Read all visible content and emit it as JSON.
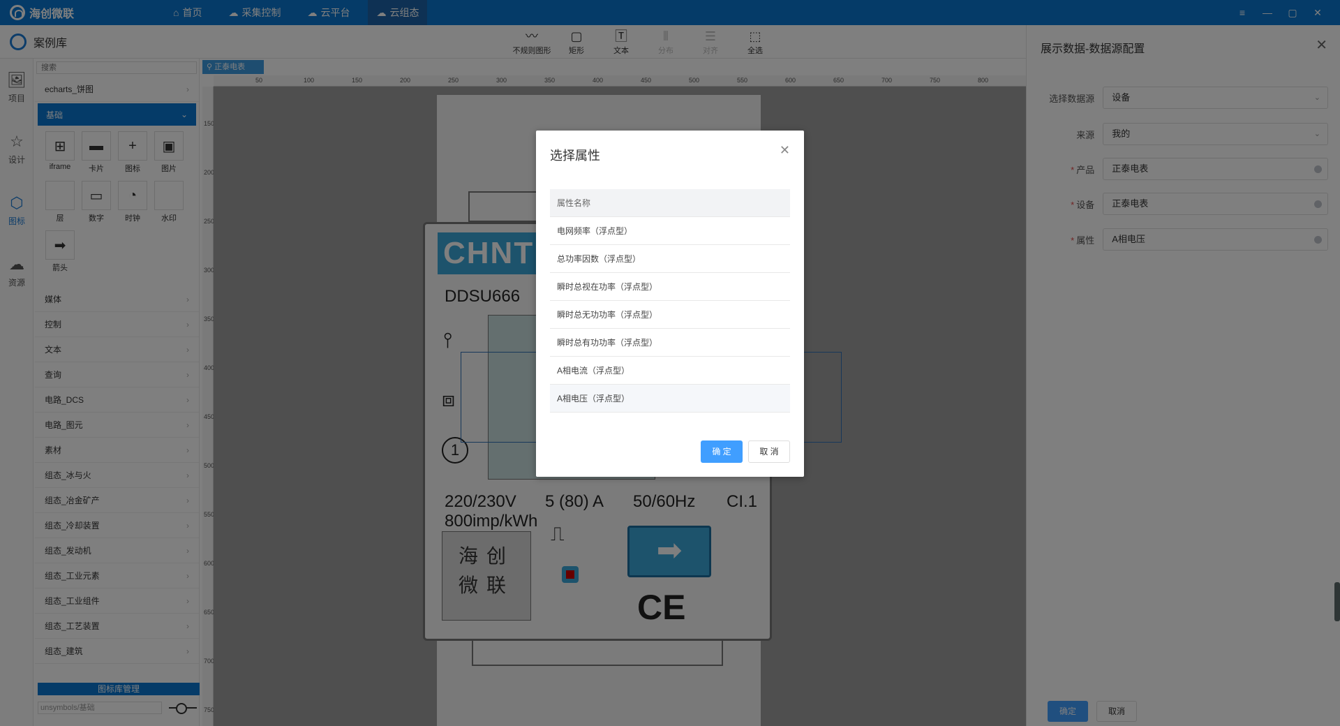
{
  "topbar": {
    "brand": "海创微联",
    "nav": [
      {
        "label": "首页",
        "icon": "⌂"
      },
      {
        "label": "采集控制",
        "icon": "☁"
      },
      {
        "label": "云平台",
        "icon": "☁"
      },
      {
        "label": "云组态",
        "icon": "☁"
      }
    ],
    "active_nav": "云组态",
    "window_controls": [
      "≡",
      "—",
      "▢",
      "✕"
    ]
  },
  "subheader": {
    "title": "案例库",
    "tools": [
      {
        "label": "不规则图形",
        "icon": "wave-icon",
        "disabled": false
      },
      {
        "label": "矩形",
        "icon": "rect-icon",
        "disabled": false
      },
      {
        "label": "文本",
        "icon": "text-icon",
        "disabled": false
      },
      {
        "label": "分布",
        "icon": "distribute-icon",
        "disabled": true
      },
      {
        "label": "对齐",
        "icon": "align-icon",
        "disabled": true
      },
      {
        "label": "全选",
        "icon": "select-all-icon",
        "disabled": false
      }
    ]
  },
  "rail": {
    "items": [
      {
        "label": "项目",
        "icon": "image-icon"
      },
      {
        "label": "设计",
        "icon": "design-icon"
      },
      {
        "label": "图标",
        "icon": "shapes-icon"
      },
      {
        "label": "资源",
        "icon": "cloud-upload-icon"
      }
    ],
    "active": "图标"
  },
  "library": {
    "search_placeholder": "搜索",
    "top_row": "echarts_饼图",
    "active_group": "基础",
    "grid": [
      {
        "label": "iframe",
        "icon": "⊞"
      },
      {
        "label": "卡片",
        "icon": "▬"
      },
      {
        "label": "图标",
        "icon": "+"
      },
      {
        "label": "图片",
        "icon": "▣"
      },
      {
        "label": "层",
        "icon": ""
      },
      {
        "label": "数字",
        "icon": "▭"
      },
      {
        "label": "时钟",
        "icon": "◔"
      },
      {
        "label": "水印",
        "icon": ""
      },
      {
        "label": "箭头",
        "icon": "➡"
      }
    ],
    "groups": [
      "媒体",
      "控制",
      "文本",
      "查询",
      "电路_DCS",
      "电路_图元",
      "素材",
      "组态_冰与火",
      "组态_冶金矿产",
      "组态_冷却装置",
      "组态_发动机",
      "组态_工业元素",
      "组态_工业组件",
      "组态_工艺装置",
      "组态_建筑"
    ],
    "footer_title": "图标库管理",
    "footer_input": "unsymbols/基础"
  },
  "canvas": {
    "tab": "正泰电表",
    "ruler_h": [
      "50",
      "100",
      "150",
      "200",
      "250",
      "300",
      "350",
      "400",
      "450",
      "500",
      "550",
      "600",
      "650",
      "700",
      "750",
      "800"
    ],
    "ruler_v": [
      "150",
      "200",
      "250",
      "300",
      "350",
      "400",
      "450",
      "500",
      "550",
      "600",
      "650",
      "700",
      "750",
      "800"
    ],
    "meter": {
      "brand": "CHNT",
      "model": "DDSU666",
      "voltage": "220/230V",
      "current": "5 (80) A",
      "freq": "50/60Hz",
      "class": "CI.1",
      "imp": "800imp/kWh",
      "logo_line1": "海创",
      "logo_line2": "微联",
      "circle_num": "1",
      "ce": "CE"
    }
  },
  "right_panel": {
    "title": "展示数据-数据源配置",
    "fields": [
      {
        "label": "选择数据源",
        "value": "设备",
        "required": false,
        "type": "select"
      },
      {
        "label": "来源",
        "value": "我的",
        "required": false,
        "type": "select"
      },
      {
        "label": "产品",
        "value": "正泰电表",
        "required": true,
        "type": "clear"
      },
      {
        "label": "设备",
        "value": "正泰电表",
        "required": true,
        "type": "clear"
      },
      {
        "label": "属性",
        "value": "A相电压",
        "required": true,
        "type": "clear"
      }
    ],
    "ok": "确定",
    "cancel": "取消"
  },
  "modal": {
    "title": "选择属性",
    "header": "属性名称",
    "rows": [
      "电网频率（浮点型）",
      "总功率因数（浮点型）",
      "瞬时总视在功率（浮点型）",
      "瞬时总无功功率（浮点型）",
      "瞬时总有功功率（浮点型）",
      "A相电流（浮点型）",
      "A相电压（浮点型）"
    ],
    "selected_index": 6,
    "ok": "确 定",
    "cancel": "取 消"
  }
}
